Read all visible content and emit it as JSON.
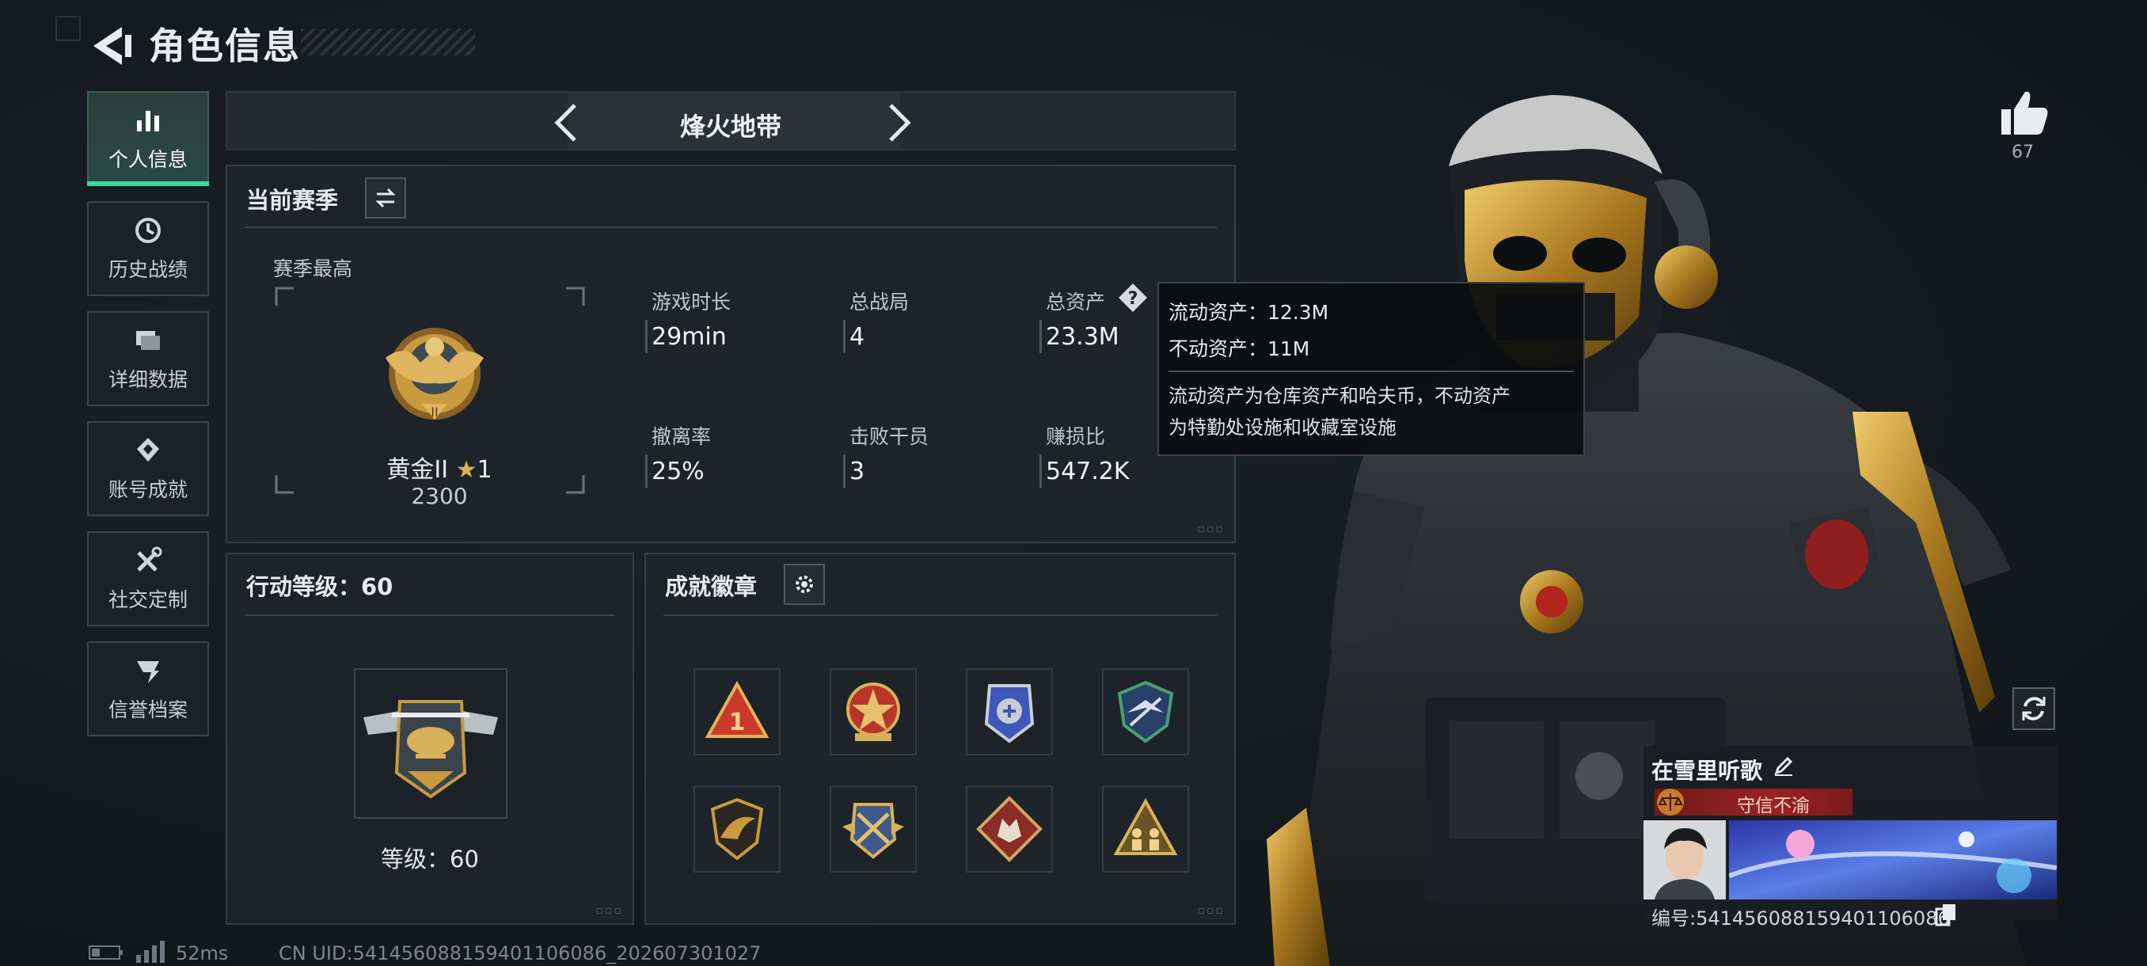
{
  "header": {
    "title": "角色信息"
  },
  "sidebar": {
    "items": [
      {
        "label": "个人信息",
        "icon": "bar-chart-icon",
        "active": true
      },
      {
        "label": "历史战绩",
        "icon": "clock-history-icon",
        "active": false
      },
      {
        "label": "详细数据",
        "icon": "folder-icon",
        "active": false
      },
      {
        "label": "账号成就",
        "icon": "achievement-icon",
        "active": false
      },
      {
        "label": "社交定制",
        "icon": "tools-icon",
        "active": false
      },
      {
        "label": "信誉档案",
        "icon": "reputation-icon",
        "active": false
      }
    ]
  },
  "mode": {
    "name": "烽火地带"
  },
  "season": {
    "heading": "当前赛季",
    "best_label": "赛季最高",
    "rank_name": "黄金II",
    "rank_stars": "1",
    "rank_points": "2300",
    "stats": [
      {
        "label": "游戏时长",
        "value": "29min"
      },
      {
        "label": "总战局",
        "value": "4"
      },
      {
        "label": "总资产",
        "value": "23.3M"
      },
      {
        "label": "撤离率",
        "value": "25%"
      },
      {
        "label": "击败干员",
        "value": "3"
      },
      {
        "label": "赚损比",
        "value": "547.2K"
      }
    ]
  },
  "tooltip": {
    "liquid": "流动资产：12.3M",
    "fixed": "不动资产：11M",
    "desc_line1": "流动资产为仓库资产和哈夫币，不动资产",
    "desc_line2": "为特勤处设施和收藏室设施"
  },
  "action_level": {
    "heading": "行动等级：60",
    "level_label": "等级：60"
  },
  "achievements": {
    "heading": "成就徽章",
    "badges": [
      "triangle-one-badge",
      "star-shield-badge",
      "police-badge",
      "eagle-shield-badge",
      "falcon-badge",
      "winged-crossed-badge",
      "wolf-diamond-badge",
      "soldiers-badge"
    ]
  },
  "like": {
    "count": "67"
  },
  "player": {
    "name": "在雪里听歌",
    "honor": "守信不渝",
    "id_text": "编号:541456088159401106086"
  },
  "status": {
    "latency": "52ms",
    "uid": "CN UID:541456088159401106086_202607301027"
  },
  "colors": {
    "accent": "#3fd6a0",
    "honor_red": "#9a2222",
    "gold": "#c99a3e"
  }
}
